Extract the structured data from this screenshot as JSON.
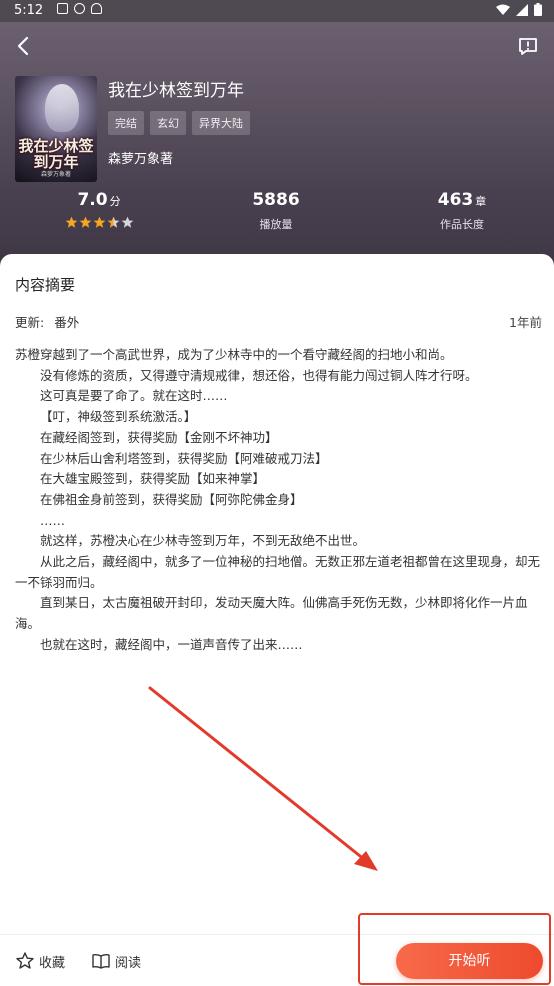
{
  "status_bar": {
    "time": "5:12"
  },
  "book": {
    "title": "我在少林签到万年",
    "cover_title": "我在少林签到万年",
    "cover_author": "森萝万象著",
    "tags": [
      "完结",
      "玄幻",
      "异界大陆"
    ],
    "author": "森萝万象著"
  },
  "stats": {
    "rating": "7.0",
    "rating_unit": "分",
    "rating_stars": 3.5,
    "plays": "5886",
    "plays_label": "播放量",
    "chapters": "463",
    "chapters_unit": "章",
    "chapters_label": "作品长度"
  },
  "summary": {
    "heading": "内容摘要",
    "update_prefix": "更新:",
    "update_value": "番外",
    "update_time": "1年前",
    "paragraphs": [
      {
        "text": "苏橙穿越到了一个高武世界，成为了少林寺中的一个看守藏经阁的扫地小和尚。",
        "indent": false
      },
      {
        "text": "没有修炼的资质，又得遵守清规戒律，想还俗，也得有能力闯过铜人阵才行呀。",
        "indent": true
      },
      {
        "text": "这可真是要了命了。就在这时……",
        "indent": true
      },
      {
        "text": "【叮，神级签到系统激活。】",
        "indent": true
      },
      {
        "text": "在藏经阁签到，获得奖励【金刚不坏神功】",
        "indent": true
      },
      {
        "text": "在少林后山舍利塔签到，获得奖励【阿难破戒刀法】",
        "indent": true
      },
      {
        "text": "在大雄宝殿签到，获得奖励【如来神掌】",
        "indent": true
      },
      {
        "text": "在佛祖金身前签到，获得奖励【阿弥陀佛金身】",
        "indent": true
      },
      {
        "text": "……",
        "indent": true
      },
      {
        "text": "就这样，苏橙决心在少林寺签到万年，不到无敌绝不出世。",
        "indent": true
      },
      {
        "text": "从此之后，藏经阁中，就多了一位神秘的扫地僧。无数正邪左道老祖都曾在这里现身，却无一不铩羽而归。",
        "indent": true
      },
      {
        "text": "直到某日，太古魔祖破开封印，发动天魔大阵。仙佛高手死伤无数，少林即将化作一片血海。",
        "indent": true
      },
      {
        "text": "也就在这时，藏经阁中，一道声音传了出来……",
        "indent": true
      }
    ]
  },
  "bottom_bar": {
    "collect_label": "收藏",
    "read_label": "阅读",
    "listen_label": "开始听"
  },
  "colors": {
    "accent": "#ee4a2e",
    "annotation": "#e23b2a",
    "star": "#f5a623"
  }
}
